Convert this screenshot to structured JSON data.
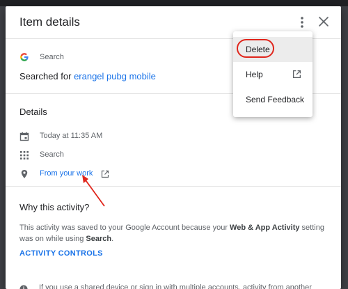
{
  "dialog": {
    "title": "Item details"
  },
  "search_section": {
    "product": "Search",
    "searched_prefix": "Searched for",
    "query": "erangel pubg mobile"
  },
  "details": {
    "heading": "Details",
    "rows": [
      {
        "icon": "calendar-icon",
        "text": "Today at 11:35 AM"
      },
      {
        "icon": "apps-grid-icon",
        "text": "Search"
      },
      {
        "icon": "location-pin-icon",
        "text": "From your work"
      }
    ]
  },
  "why": {
    "heading": "Why this activity?",
    "text_1": "This activity was saved to your Google Account because your ",
    "bold_1": "Web & App Activity",
    "text_2": " setting was on while using ",
    "bold_2": "Search",
    "text_3": ".",
    "controls_link": "ACTIVITY CONTROLS",
    "partial_text": "If you use a shared device or sign in with multiple accounts, activity from another"
  },
  "menu": {
    "items": [
      {
        "label": "Delete"
      },
      {
        "label": "Help",
        "icon": "external-link-icon"
      },
      {
        "label": "Send Feedback"
      }
    ]
  },
  "colors": {
    "link": "#1a73e8",
    "annotation": "#e0251b"
  }
}
